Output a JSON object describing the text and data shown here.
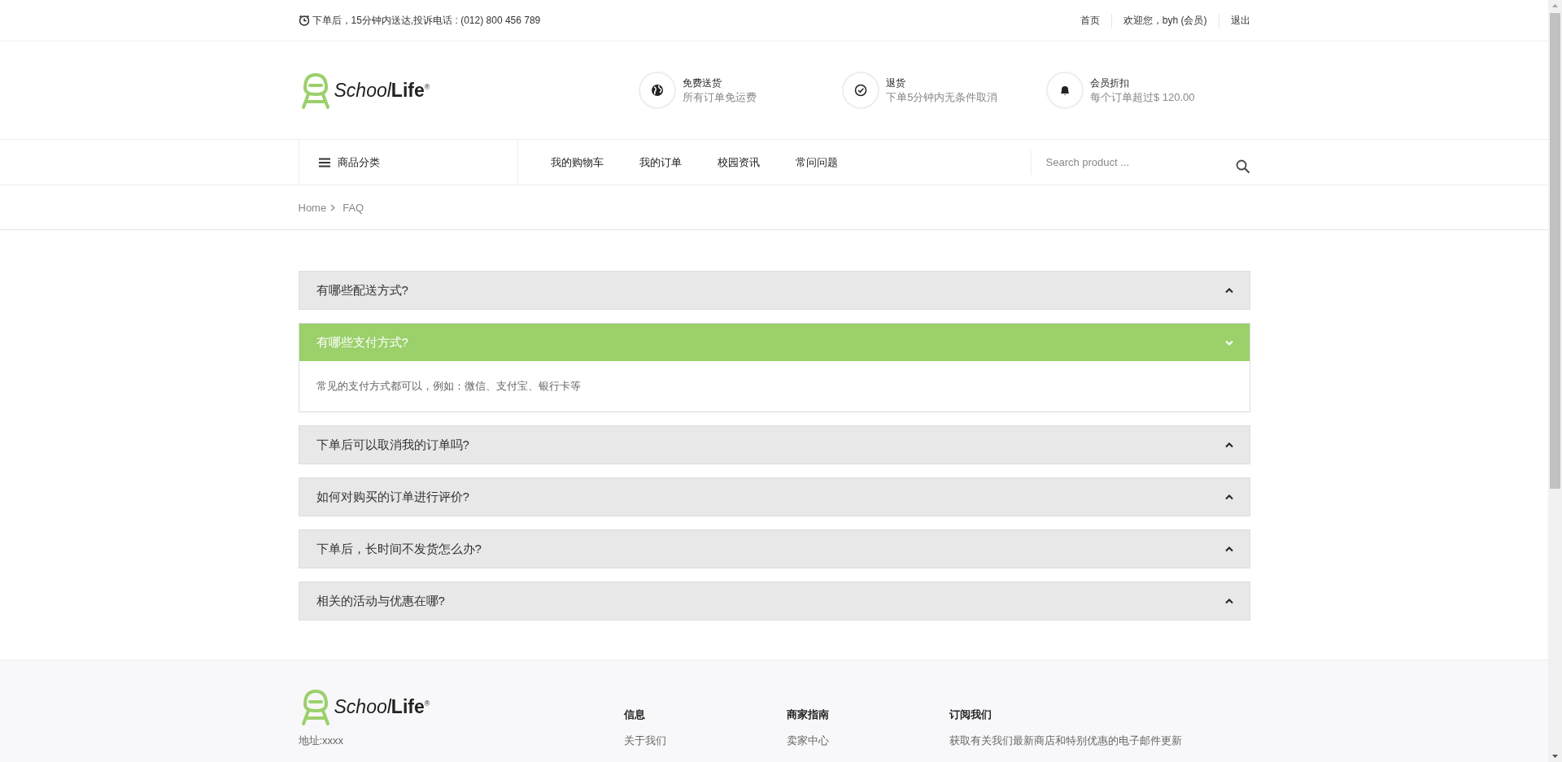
{
  "top_bar": {
    "notice": "下单后，15分钟内送达,投诉电话 : (012) 800 456 789",
    "links": [
      "首页",
      "欢迎您，byh (会员)",
      "退出"
    ]
  },
  "header": {
    "logo": {
      "first": "School",
      "second": "Life",
      "mark": "®"
    },
    "features": [
      {
        "kind": "globe",
        "title": "免费送货",
        "subtitle": "所有订单免运费"
      },
      {
        "kind": "check",
        "title": "退货",
        "subtitle": "下单5分钟内无条件取消"
      },
      {
        "kind": "bell",
        "title": "会员折扣",
        "subtitle": "每个订单超过$ 120.00"
      }
    ]
  },
  "nav": {
    "category_button": "商品分类",
    "items": [
      "我的购物车",
      "我的订单",
      "校园资讯",
      "常问问题"
    ],
    "search": {
      "placeholder": "Search product ..."
    }
  },
  "breadcrumb": [
    "Home",
    "FAQ"
  ],
  "faq": [
    {
      "question": "有哪些配送方式?",
      "expanded": false
    },
    {
      "question": "有哪些支付方式?",
      "expanded": true,
      "answer": "常见的支付方式都可以，例如：微信、支付宝、银行卡等"
    },
    {
      "question": "下单后可以取消我的订单吗?",
      "expanded": false
    },
    {
      "question": "如何对购买的订单进行评价?",
      "expanded": false
    },
    {
      "question": "下单后，长时间不发货怎么办?",
      "expanded": false
    },
    {
      "question": "相关的活动与优惠在哪?",
      "expanded": false
    }
  ],
  "footer": {
    "logo": {
      "first": "School",
      "second": "Life",
      "mark": "®"
    },
    "address": "地址:xxxx",
    "columns": [
      {
        "heading": "信息",
        "items": [
          "关于我们"
        ]
      },
      {
        "heading": "商家指南",
        "items": [
          "卖家中心"
        ]
      },
      {
        "heading": "订阅我们",
        "items": [
          "获取有关我们最新商店和特别优惠的电子邮件更新"
        ]
      }
    ]
  }
}
